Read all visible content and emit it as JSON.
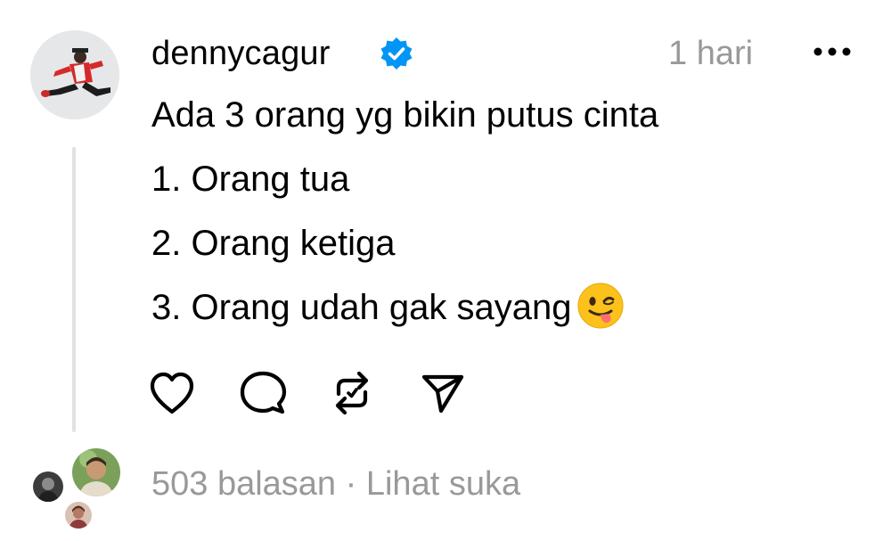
{
  "post": {
    "username": "dennycagur",
    "time": "1 hari",
    "lines": [
      "Ada 3 orang yg bikin putus cinta",
      "1. Orang tua",
      "2. Orang ketiga",
      "3. Orang udah gak sayang"
    ],
    "emoji_name": "winking-face-with-tongue"
  },
  "footer": {
    "replies": "503 balasan",
    "separator": " · ",
    "likes_link": "Lihat suka"
  },
  "colors": {
    "verified": "#0095f6",
    "muted_text": "#999999",
    "thread_line": "#e2e2e2"
  }
}
